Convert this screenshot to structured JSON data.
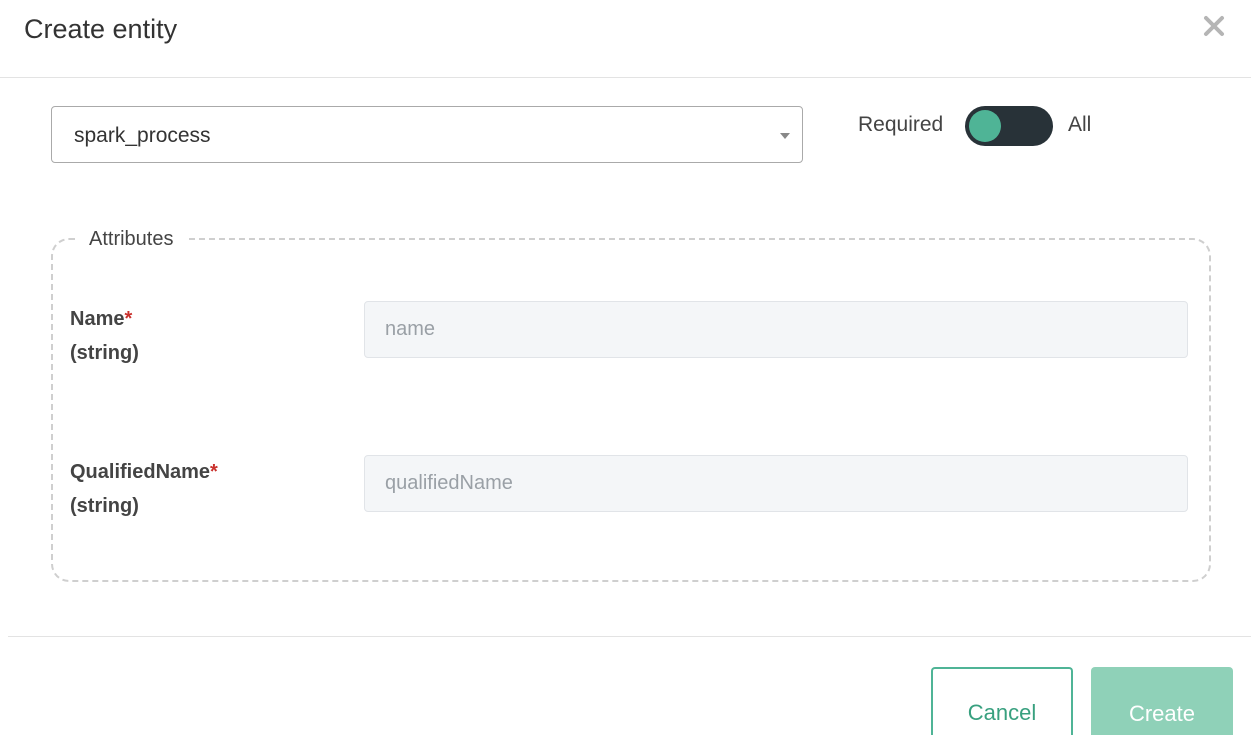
{
  "dialog": {
    "title": "Create entity"
  },
  "entity_type": {
    "selected": "spark_process"
  },
  "toggle": {
    "left_label": "Required",
    "right_label": "All",
    "state": "Required"
  },
  "attributes": {
    "legend": "Attributes",
    "fields": [
      {
        "label": "Name",
        "required_mark": "*",
        "type": "(string)",
        "value": "",
        "placeholder": "name"
      },
      {
        "label": "QualifiedName",
        "required_mark": "*",
        "type": "(string)",
        "value": "",
        "placeholder": "qualifiedName"
      }
    ]
  },
  "footer": {
    "cancel_label": "Cancel",
    "create_label": "Create"
  },
  "colors": {
    "accent": "#4fb496",
    "create_disabled": "#8fd1b8",
    "toggle_track": "#283238",
    "required_mark": "#c9302c"
  }
}
